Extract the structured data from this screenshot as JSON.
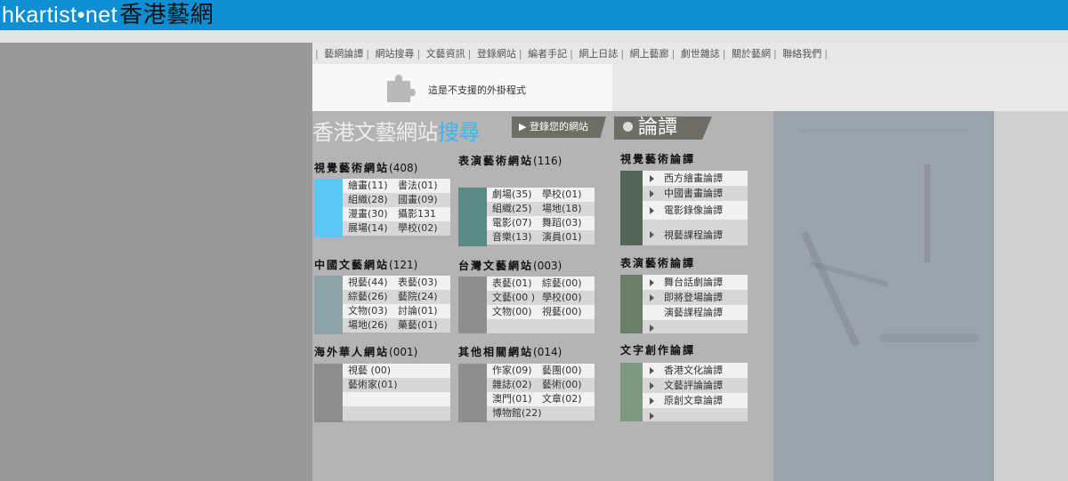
{
  "logo": {
    "latin": "hkartist•net",
    "chinese": "香港藝網"
  },
  "nav": {
    "items": [
      "藝網論譚",
      "網站搜尋",
      "文藝資訊",
      "登錄網站",
      "編者手記",
      "網上日誌",
      "網上藝廊",
      "劇世雜誌",
      "關於藝網",
      "聯絡我們"
    ]
  },
  "plugin": {
    "message": "這是不支援的外掛程式"
  },
  "headline": {
    "part1": "香港文藝網站",
    "part2": "搜尋"
  },
  "register_button": "登錄您的網站",
  "forum_button": "論譚",
  "colors": {
    "topbar": "#0f8fd3",
    "accent_blue": "#3fb5ee"
  },
  "sections": {
    "visual": {
      "title": "視覺藝術網站",
      "count": "(408)",
      "color": "#5bc8f8",
      "rows": [
        [
          "繪畫(11)",
          "書法(01)"
        ],
        [
          "組織(28)",
          "國畫(09)"
        ],
        [
          "漫畫(30)",
          "攝影131"
        ],
        [
          "展場(14)",
          "學校(02)"
        ]
      ]
    },
    "performing": {
      "title": "表演藝術網站",
      "count": "(116)",
      "color": "#5c8a86",
      "rows": [
        [
          "劇場(35)",
          "學校(01)"
        ],
        [
          "組織(25)",
          "場地(18)"
        ],
        [
          "電影(07)",
          "舞蹈(03)"
        ],
        [
          "音樂(13)",
          "演員(01)"
        ]
      ]
    },
    "china": {
      "title": "中國文藝網站",
      "count": "(121)",
      "color": "#8ea4a8",
      "rows": [
        [
          "視藝(44)",
          "表藝(03)"
        ],
        [
          "綜藝(26)",
          "藝院(24)"
        ],
        [
          "文物(03)",
          "討論(01)"
        ],
        [
          "場地(26)",
          "藥藝(01)"
        ]
      ]
    },
    "taiwan": {
      "title": "台灣文藝網站",
      "count": "(003)",
      "color": "#8e8e8e",
      "rows": [
        [
          "表藝(01)",
          "綜藝(00)"
        ],
        [
          "文藝(00 )",
          "學校(00)"
        ],
        [
          "文物(00)",
          "視藝(00)"
        ]
      ]
    },
    "overseas": {
      "title": "海外華人網站",
      "count": "(001)",
      "color": "#8e8e8e",
      "rows": [
        [
          "視藝 (00)"
        ],
        [
          "藝術家(01)"
        ]
      ]
    },
    "other": {
      "title": "其他相關網站",
      "count": "(014)",
      "color": "#8e8e8e",
      "rows": [
        [
          "作家(09)",
          "藝團(00)"
        ],
        [
          "雜誌(02)",
          "藝術(00)"
        ],
        [
          "澳門(01)",
          "文章(02)"
        ],
        [
          "博物館(22)"
        ]
      ]
    }
  },
  "forums": {
    "visual": {
      "title": "視覺藝術論譚",
      "color": "#556557",
      "items": [
        "西方繪畫論譚",
        "中國書畫論譚",
        "電影錄像論譚",
        "視藝課程論譚"
      ]
    },
    "performing": {
      "title": "表演藝術論譚",
      "color": "#6a7e69",
      "items": [
        "舞台話劇論譚",
        "即將登場論譚",
        "演藝課程論譚"
      ]
    },
    "writing": {
      "title": "文字創作論譚",
      "color": "#7e9980",
      "items": [
        "香港文化論譚",
        "文藝評論論譚",
        "原創文章論譚"
      ]
    }
  }
}
